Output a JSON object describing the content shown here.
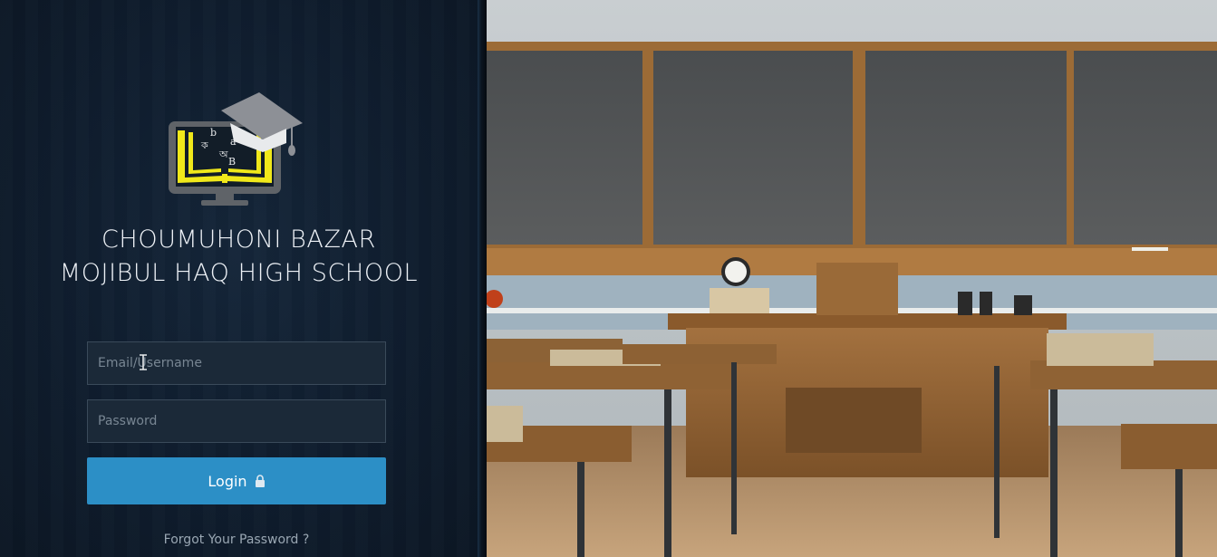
{
  "school": {
    "name_line1": "CHOUMUHONI BAZAR",
    "name_line2": "MOJIBUL HAQ HIGH SCHOOL"
  },
  "logo": {
    "icon": "graduation-monitor-book-logo",
    "letters": [
      "b",
      "a",
      "ক",
      "অ",
      "B"
    ],
    "colors": {
      "book": "#f0e81a",
      "monitor": "#5f6368",
      "cap": "#8d9096"
    }
  },
  "form": {
    "email_placeholder": "Email/Username",
    "email_value": "",
    "password_placeholder": "Password",
    "password_value": "",
    "login_label": "Login",
    "login_icon": "lock-icon",
    "forgot_label": "Forgot Your Password ?"
  },
  "colors": {
    "panel_bg": "#0f1d2e",
    "button": "#2c8fc6",
    "field_bg": "#1b2938"
  },
  "background_image": "classroom-with-chalkboards-and-desks"
}
